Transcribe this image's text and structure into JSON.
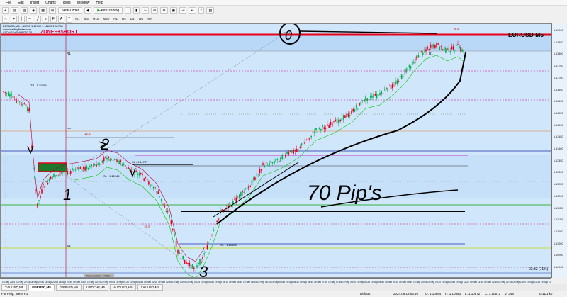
{
  "menu": [
    "File",
    "Edit",
    "Insert",
    "Charts",
    "Tools",
    "Window",
    "Help"
  ],
  "toolbar": {
    "new_order": "New Order",
    "autotrading": "AutoTrading"
  },
  "timeframes": [
    "M1",
    "M5",
    "M15",
    "M30",
    "H1",
    "H4",
    "D1",
    "W1",
    "MN"
  ],
  "chart": {
    "info_line1": "EURUSD,M5 1.11733 1.11749 1.11693 1.11708",
    "info_line2": "www.tradingfinder.com",
    "info_line3": "#ZONES+SHORT 0.20",
    "zones_label": "ZONES+SHORT",
    "symbol": "EURUSD  M5",
    "r1": "R1",
    "r1_right": "R1",
    "pp": "PP",
    "s1": "S1",
    "fib_55": "55.4",
    "fib_122": "12.2",
    "fib_16": "16.5",
    "fib_8": "8.4",
    "tp_label": "TP - 1.11554",
    "sl_label": "SL - 1.11787",
    "sl_label2": "SL - 1.11746",
    "sl_label3": "SL - 1.10605",
    "countdown": "03:32 (71%)",
    "watermark": "Webmaster: FXSS",
    "annot_0": "0",
    "annot_1": "1",
    "annot_2": "2",
    "annot_3": "3",
    "annot_pips": "70 Pip's"
  },
  "price_axis": [
    "1.11900",
    "1.11850",
    "1.11800",
    "1.11750",
    "1.11700",
    "1.11650",
    "1.11600",
    "1.11550",
    "1.11500",
    "1.11450",
    "1.11400",
    "1.11350",
    "1.11300",
    "1.11250",
    "1.11200",
    "1.11150",
    "1.11100",
    "1.11050",
    "1.11000",
    "1.10950",
    "1.10900"
  ],
  "time_axis": [
    "18 Sep 2024",
    "18 Sep 22:25",
    "18 Sep 22:50",
    "18 Sep 23:05",
    "18 Sep 23:40",
    "19 Sep 00:05",
    "19 Sep 00:30",
    "19 Sep 00:55",
    "19 Sep 01:20",
    "19 Sep 01:45",
    "19 Sep 02:10",
    "19 Sep 02:35",
    "19 Sep 03:00",
    "19 Sep 03:25",
    "19 Sep 03:50",
    "19 Sep 04:15",
    "19 Sep 04:40",
    "19 Sep 05:05",
    "19 Sep 05:30",
    "19 Sep 05:55",
    "19 Sep 06:20",
    "19 Sep 06:45",
    "19 Sep 07:10",
    "19 Sep 07:35",
    "19 Sep 08:00",
    "19 Sep 08:25",
    "19 Sep 08:50",
    "19 Sep 09:15",
    "19 Sep 09:40",
    "19 Sep 10:05",
    "19 Sep 10:30",
    "19 Sep 10:55",
    "19 Sep 11:20",
    "19 Sep 11:45",
    "19 Sep 12:10",
    "19 Sep 12:35",
    "19 Sep 13:00",
    "19 Sep 13:25",
    "19 Sep 13:50"
  ],
  "tabs": [
    "XAUUSD,M5",
    "EURUSD,M5",
    "GBPUSD,M5",
    "USDCHF,M5",
    "AUDUSD,M5",
    "XAUUSD,M5"
  ],
  "status": {
    "help": "For Help, press F1",
    "profile": "Default",
    "datetime": "2024.09.19 05:40",
    "open": "O: 1.10864",
    "high": "H: 1.10863",
    "low": "L: 1.10872",
    "close": "C: 1.10872",
    "volume": "V: 348",
    "traffic": "5211/1 kb"
  },
  "colors": {
    "chart_bg": "#cfe6fb",
    "bull": "#00b050",
    "bear": "#e8001a",
    "resistance": "#e8001a",
    "green_ma": "#00c800",
    "red_ma": "#b00030"
  }
}
